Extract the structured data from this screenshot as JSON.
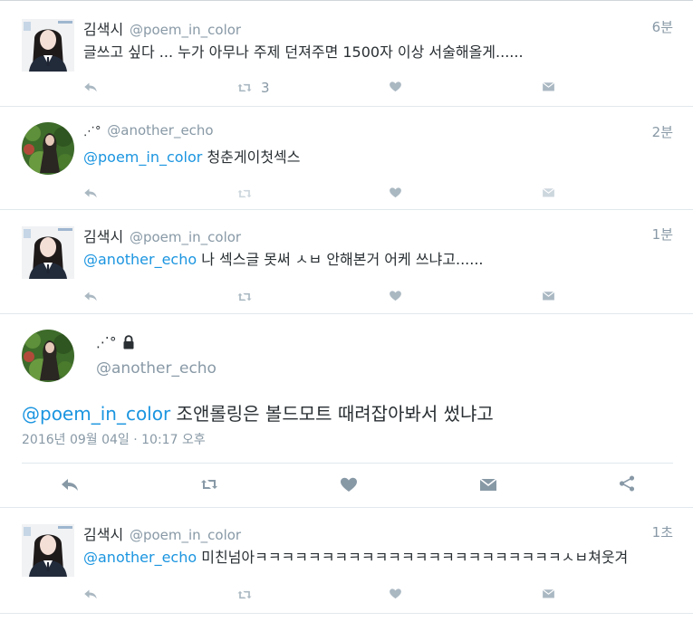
{
  "tweets": [
    {
      "name": "김색시",
      "handle": "@poem_in_color",
      "time": "6분",
      "text": "글쓰고 싶다 ... 누가 아무나 주제 던져주면 1500자 이상 서술해올게......",
      "retweet_count": "3"
    },
    {
      "name_emoji": "⋰°",
      "handle": "@another_echo",
      "time": "2분",
      "mention": "@poem_in_color",
      "text": " 청춘게이첫섹스"
    },
    {
      "name": "김색시",
      "handle": "@poem_in_color",
      "time": "1분",
      "mention": "@another_echo",
      "text": " 나 섹스글 못써 ㅅㅂ 안해본거 어케 쓰냐고......"
    }
  ],
  "focused": {
    "name_emoji": "⋰°",
    "handle": "@another_echo",
    "mention": "@poem_in_color",
    "text": " 조앤롤링은 볼드모트 때려잡아봐서 썼냐고",
    "date": "2016년 09월 04일 · 10:17 오후"
  },
  "last_tweet": {
    "name": "김색시",
    "handle": "@poem_in_color",
    "time": "1초",
    "mention": "@another_echo",
    "text": " 미친넘아ㅋㅋㅋㅋㅋㅋㅋㅋㅋㅋㅋㅋㅋㅋㅋㅋㅋㅋㅋㅋㅋㅋㅋㅅㅂ쳐웃겨"
  },
  "icons": {
    "reply": "reply-icon",
    "retweet": "retweet-icon",
    "like": "heart-icon",
    "dm": "envelope-icon",
    "share": "share-icon",
    "lock": "lock-icon"
  },
  "colors": {
    "mention": "#1b95e0",
    "muted": "#8899a6",
    "icon": "#aab8c2"
  }
}
